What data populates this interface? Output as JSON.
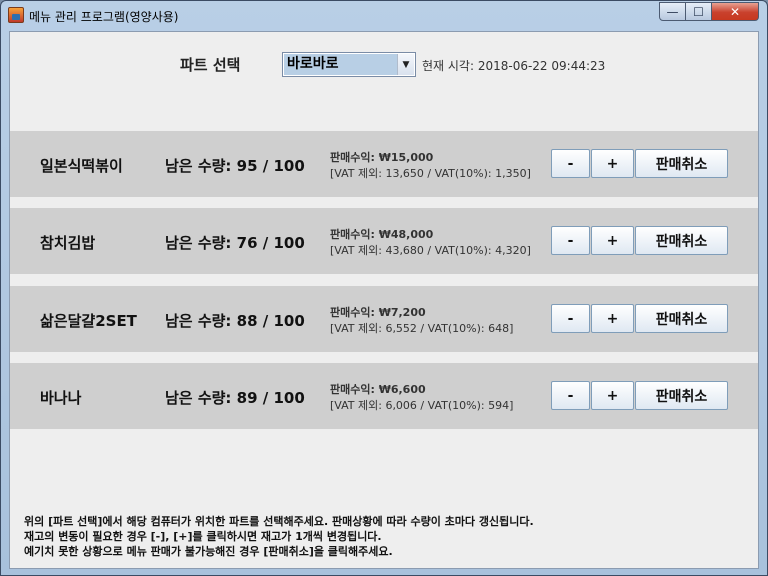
{
  "window": {
    "title": "메뉴 관리 프로그램(영양사용)",
    "minimize_glyph": "—",
    "maximize_glyph": "☐",
    "close_glyph": "✕"
  },
  "header": {
    "part_label": "파트 선택",
    "part_selected": "바로바로",
    "dropdown_arrow": "▼",
    "time_label": "현재 시각: 2018-06-22 09:44:23"
  },
  "items": [
    {
      "name": "일본식떡볶이",
      "stock": "남은 수량: 95 / 100",
      "revenue": "판매수익: ₩15,000",
      "vat": "[VAT 제외: 13,650 / VAT(10%): 1,350]"
    },
    {
      "name": "참치김밥",
      "stock": "남은 수량: 76 / 100",
      "revenue": "판매수익: ₩48,000",
      "vat": "[VAT 제외: 43,680 / VAT(10%): 4,320]"
    },
    {
      "name": "삶은달걀2SET",
      "stock": "남은 수량: 88 / 100",
      "revenue": "판매수익: ₩7,200",
      "vat": "[VAT 제외: 6,552 / VAT(10%): 648]"
    },
    {
      "name": "바나나",
      "stock": "남은 수량: 89 / 100",
      "revenue": "판매수익: ₩6,600",
      "vat": "[VAT 제외: 6,006 / VAT(10%): 594]"
    }
  ],
  "buttons": {
    "minus": "-",
    "plus": "+",
    "cancel": "판매취소"
  },
  "notes": [
    "위의 [파트 선택]에서 해당 컴퓨터가 위치한 파트를 선택해주세요. 판매상황에 따라 수량이 초마다 갱신됩니다.",
    "재고의 변동이 필요한 경우 [-], [+]를 클릭하시면 재고가 1개씩 변경됩니다.",
    "예기치 못한 상황으로 메뉴 판매가 불가능해진 경우 [판매취소]을 클릭해주세요."
  ]
}
